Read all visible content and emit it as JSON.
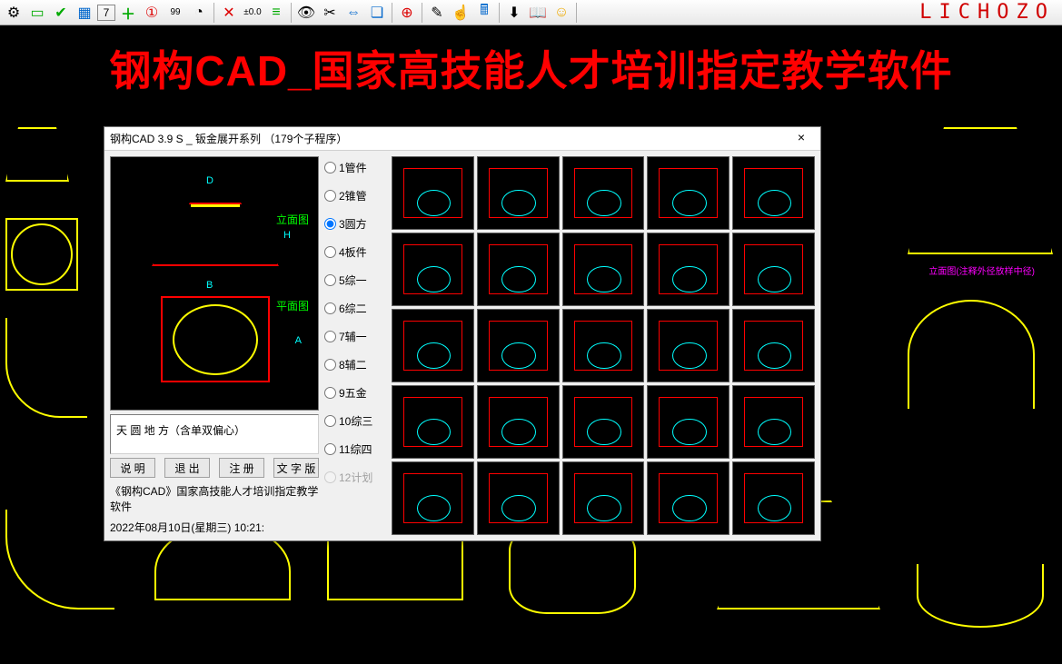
{
  "toolbar": {
    "icons": [
      "gear-icon",
      "rect-green-icon",
      "check-icon",
      "grid-icon",
      "calendar-7-icon",
      "plus-icon",
      "circle-1-icon",
      "badge-99-icon",
      "fan-icon",
      "separator",
      "axis-icon",
      "tolerance-icon",
      "lines-icon",
      "separator",
      "eye-icon",
      "scissors-icon",
      "arrows-h-icon",
      "layers-icon",
      "separator",
      "zoom-plus-icon",
      "separator",
      "brush-icon",
      "hand-icon",
      "calculator-icon",
      "separator",
      "download-icon",
      "book-check-icon",
      "smiley-icon",
      "separator"
    ],
    "labels": {
      "tolerance": "±0.0"
    },
    "logo": "LICHOZO"
  },
  "banner": "钢构CAD_国家高技能人才培训指定教学软件",
  "dialog": {
    "title": "钢构CAD 3.9 S _ 钣金展开系列 （179个子程序）",
    "close": "×",
    "preview": {
      "elev_label": "立面图",
      "plan_label": "平面图",
      "dim_d": "D",
      "dim_b": "B",
      "dim_h": "H",
      "dim_a": "A",
      "desc": "天 圆 地 方（含单双偏心）"
    },
    "buttons": {
      "help": "说 明",
      "exit": "退 出",
      "register": "注 册",
      "text_version": "文 字 版"
    },
    "footer1": "《钢构CAD》国家高技能人才培训指定教学软件",
    "footer2": "2022年08月10日(星期三)  10:21:",
    "radios": [
      {
        "label": "1管件",
        "checked": false
      },
      {
        "label": "2锥管",
        "checked": false
      },
      {
        "label": "3圆方",
        "checked": true
      },
      {
        "label": "4板件",
        "checked": false
      },
      {
        "label": "5综一",
        "checked": false
      },
      {
        "label": "6综二",
        "checked": false
      },
      {
        "label": "7辅一",
        "checked": false
      },
      {
        "label": "8辅二",
        "checked": false
      },
      {
        "label": "9五金",
        "checked": false
      },
      {
        "label": "10综三",
        "checked": false
      },
      {
        "label": "11综四",
        "checked": false
      },
      {
        "label": "12计划",
        "checked": false,
        "disabled": true
      }
    ]
  },
  "bg_labels": {
    "right_note": "立面图(注释外径放样中径)"
  }
}
